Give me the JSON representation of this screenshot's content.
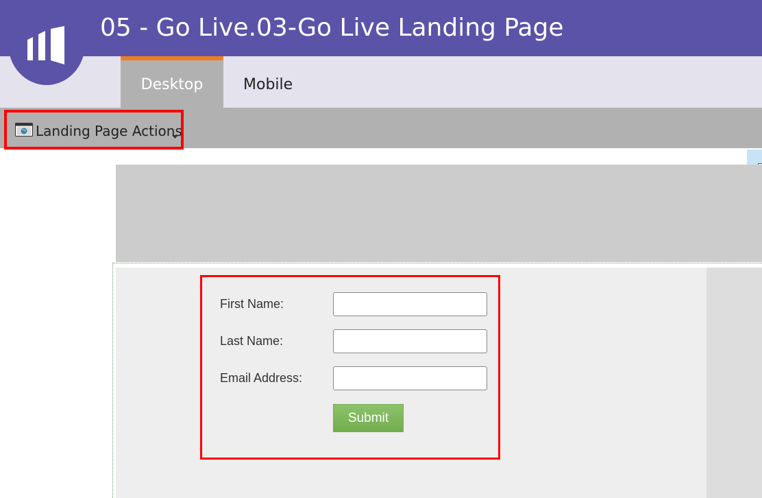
{
  "app": {
    "title": "05 - Go Live.03-Go Live Landing Page",
    "brand_color": "#5b53a8",
    "logo_icon": "marketo-logo-icon"
  },
  "tabs": [
    {
      "label": "Desktop",
      "active": true
    },
    {
      "label": "Mobile",
      "active": false
    }
  ],
  "toolbar": {
    "actions_label": "Landing Page Actions",
    "actions_icon": "landing-page-icon",
    "dropdown_icon": "caret-down-icon"
  },
  "form": {
    "fields": [
      {
        "label": "First Name:",
        "value": "",
        "placeholder": ""
      },
      {
        "label": "Last Name:",
        "value": "",
        "placeholder": ""
      },
      {
        "label": "Email Address:",
        "value": "",
        "placeholder": ""
      }
    ],
    "submit_label": "Submit",
    "highlight_color": "#ff0000"
  }
}
